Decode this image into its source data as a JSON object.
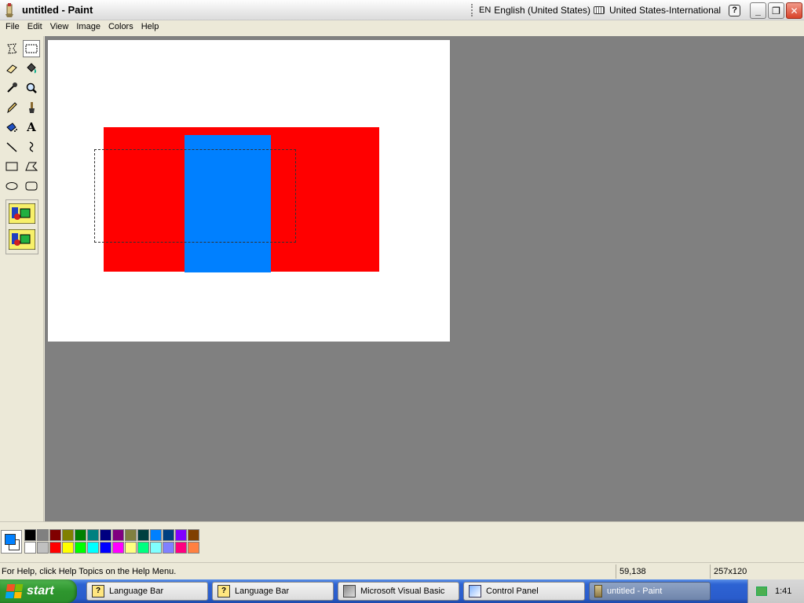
{
  "window": {
    "title": "untitled - Paint"
  },
  "langbar": {
    "lang_code": "EN",
    "language": "English (United States)",
    "keyboard": "United States-International",
    "help": "?"
  },
  "window_controls": {
    "minimize": "_",
    "restore": "❐",
    "close": "✕"
  },
  "menu": {
    "items": [
      "File",
      "Edit",
      "View",
      "Image",
      "Colors",
      "Help"
    ]
  },
  "tools": [
    "free-form-select",
    "select",
    "eraser",
    "fill-with-color",
    "pick-color",
    "magnifier",
    "pencil",
    "brush",
    "airbrush",
    "text",
    "line",
    "curve",
    "rectangle",
    "polygon",
    "ellipse",
    "rounded-rectangle"
  ],
  "canvas": {
    "shapes": [
      {
        "type": "rectangle",
        "color": "#ff0000"
      },
      {
        "type": "rectangle",
        "color": "#0080ff"
      }
    ]
  },
  "colors": {
    "foreground": "#0080ff",
    "background": "#ffffff",
    "palette_row1": [
      "#000000",
      "#808080",
      "#800000",
      "#808000",
      "#008000",
      "#008080",
      "#000080",
      "#800080",
      "#808040",
      "#004040",
      "#0080ff",
      "#004080",
      "#8000ff",
      "#804000"
    ],
    "palette_row2": [
      "#ffffff",
      "#c0c0c0",
      "#ff0000",
      "#ffff00",
      "#00ff00",
      "#00ffff",
      "#0000ff",
      "#ff00ff",
      "#ffff80",
      "#00ff80",
      "#80ffff",
      "#8080ff",
      "#ff0080",
      "#ff8040"
    ]
  },
  "status": {
    "help_text": "For Help, click Help Topics on the Help Menu.",
    "cursor": "59,138",
    "size": "257x120"
  },
  "taskbar": {
    "start_label": "start",
    "tasks": [
      "Language Bar",
      "Language Bar",
      "Microsoft Visual Basic",
      "Control Panel",
      "untitled - Paint"
    ],
    "clock": "1:41"
  }
}
